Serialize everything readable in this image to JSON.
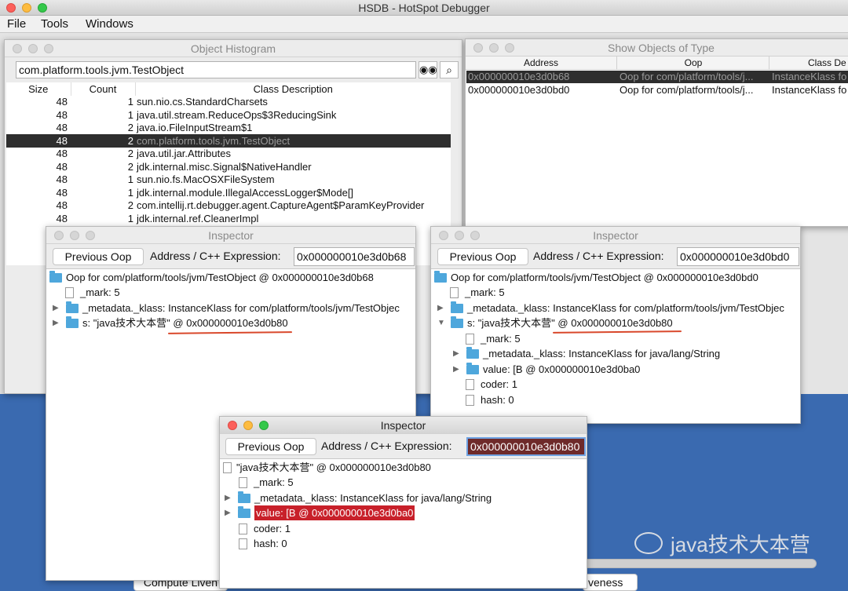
{
  "app": {
    "title": "HSDB - HotSpot Debugger"
  },
  "menubar": [
    "File",
    "Tools",
    "Windows"
  ],
  "histogram": {
    "title": "Object Histogram",
    "filter_value": "com.platform.tools.jvm.TestObject",
    "find_icon": "binoculars-icon",
    "search_icon": "magnifier-icon",
    "columns": [
      "Size",
      "Count",
      "Class Description"
    ],
    "rows": [
      {
        "size": "48",
        "count": "1",
        "desc": "sun.nio.cs.StandardCharsets"
      },
      {
        "size": "48",
        "count": "1",
        "desc": "java.util.stream.ReduceOps$3ReducingSink"
      },
      {
        "size": "48",
        "count": "2",
        "desc": "java.io.FileInputStream$1"
      },
      {
        "size": "48",
        "count": "2",
        "desc": "com.platform.tools.jvm.TestObject"
      },
      {
        "size": "48",
        "count": "2",
        "desc": "java.util.jar.Attributes"
      },
      {
        "size": "48",
        "count": "2",
        "desc": "jdk.internal.misc.Signal$NativeHandler"
      },
      {
        "size": "48",
        "count": "1",
        "desc": "sun.nio.fs.MacOSXFileSystem"
      },
      {
        "size": "48",
        "count": "1",
        "desc": "jdk.internal.module.IllegalAccessLogger$Mode[]"
      },
      {
        "size": "48",
        "count": "2",
        "desc": "com.intellij.rt.debugger.agent.CaptureAgent$ParamKeyProvider"
      },
      {
        "size": "48",
        "count": "1",
        "desc": "jdk.internal.ref.CleanerImpl"
      }
    ]
  },
  "show_objects": {
    "title": "Show Objects of Type",
    "columns": [
      "Address",
      "Oop",
      "Class De"
    ],
    "rows": [
      {
        "address": "0x000000010e3d0b68",
        "oop": "Oop for com/platform/tools/j...",
        "klass": "InstanceKlass fo"
      },
      {
        "address": "0x000000010e3d0bd0",
        "oop": "Oop for com/platform/tools/j...",
        "klass": "InstanceKlass fo"
      }
    ]
  },
  "inspector_common": {
    "title": "Inspector",
    "prev_label": "Previous Oop",
    "addr_label": "Address / C++ Expression:"
  },
  "inspector1": {
    "address": "0x000000010e3d0b68",
    "nodes": [
      "Oop for com/platform/tools/jvm/TestObject @ 0x000000010e3d0b68",
      "_mark: 5",
      "_metadata._klass: InstanceKlass for com/platform/tools/jvm/TestObjec",
      "s: \"java技术大本营\" @ 0x000000010e3d0b80"
    ]
  },
  "inspector2": {
    "address": "0x000000010e3d0bd0",
    "nodes": [
      "Oop for com/platform/tools/jvm/TestObject @ 0x000000010e3d0bd0",
      "_mark: 5",
      "_metadata._klass: InstanceKlass for com/platform/tools/jvm/TestObjec",
      "s: \"java技术大本营\" @ 0x000000010e3d0b80",
      "_mark: 5",
      "_metadata._klass: InstanceKlass for java/lang/String",
      "value: [B @ 0x000000010e3d0ba0",
      "coder: 1",
      "hash: 0"
    ]
  },
  "inspector3": {
    "address": "0x000000010e3d0b80",
    "nodes": [
      "\"java技术大本营\" @ 0x000000010e3d0b80",
      "_mark: 5",
      "_metadata._klass: InstanceKlass for java/lang/String",
      "value: [B @ 0x000000010e3d0ba0",
      "coder: 1",
      "hash: 0"
    ]
  },
  "bottom": {
    "left_button": "Compute Liven",
    "right_button": "veness"
  },
  "watermark": "java技术大本营",
  "colors": {
    "selection": "#2e2e2e",
    "highlight_red": "#c8202a",
    "desktop": "#3a6ab0",
    "underline": "#d9482b"
  }
}
